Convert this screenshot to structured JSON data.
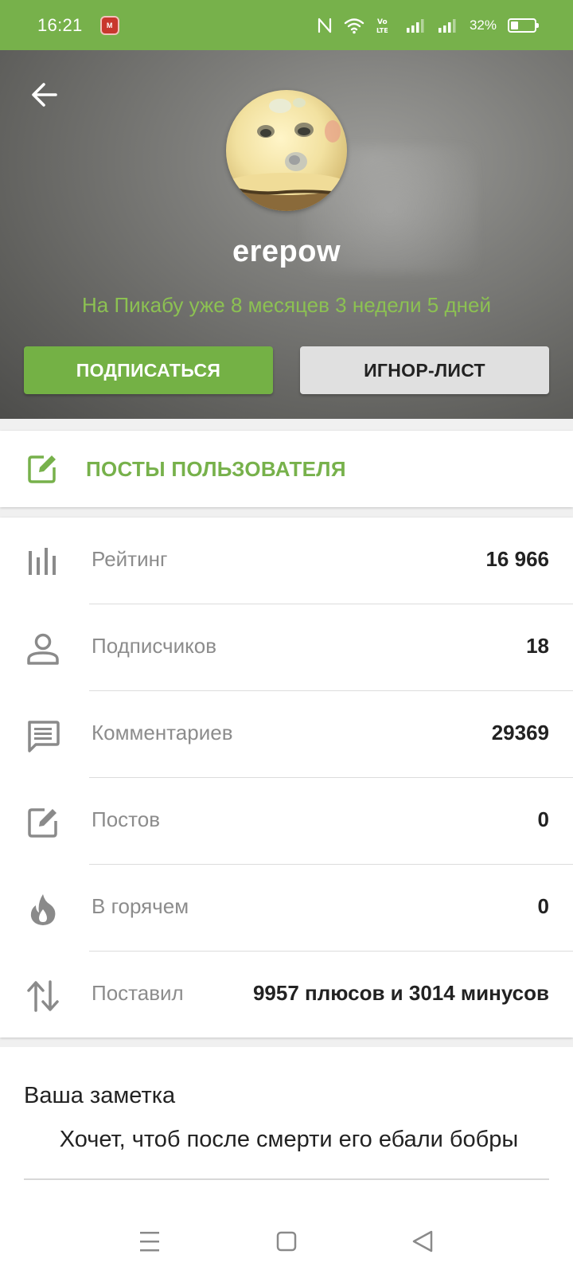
{
  "status_bar": {
    "time": "16:21",
    "app_badge": "M",
    "battery_percent": "32%",
    "battery_level": 0.32,
    "icons": [
      "nfc-icon",
      "wifi-icon",
      "volte-icon",
      "signal-icon",
      "signal-icon",
      "battery-icon"
    ]
  },
  "profile": {
    "username": "erepow",
    "tenure": "На Пикабу уже 8 месяцев 3 недели 5 дней",
    "subscribe_label": "ПОДПИСАТЬСЯ",
    "ignore_label": "ИГНОР-ЛИСТ"
  },
  "posts_link": {
    "label": "ПОСТЫ ПОЛЬЗОВАТЕЛЯ",
    "icon": "edit-icon"
  },
  "stats": [
    {
      "label": "Рейтинг",
      "value": "16 966",
      "icon": "rating-bars-icon"
    },
    {
      "label": "Подписчиков",
      "value": "18",
      "icon": "person-icon"
    },
    {
      "label": "Комментариев",
      "value": "29369",
      "icon": "comment-icon"
    },
    {
      "label": "Постов",
      "value": "0",
      "icon": "edit-icon"
    },
    {
      "label": "В горячем",
      "value": "0",
      "icon": "flame-icon"
    },
    {
      "label": "Поставил",
      "value": "9957 плюсов и 3014 минусов",
      "icon": "up-down-arrows-icon"
    }
  ],
  "note": {
    "title": "Ваша заметка",
    "text": "Хочет, чтоб после смерти его ебали бобры"
  },
  "colors": {
    "accent": "#77b14b",
    "tenure": "#8cc152",
    "stat_label": "#8c8c8c",
    "icon_gray": "#8a8a8a"
  }
}
